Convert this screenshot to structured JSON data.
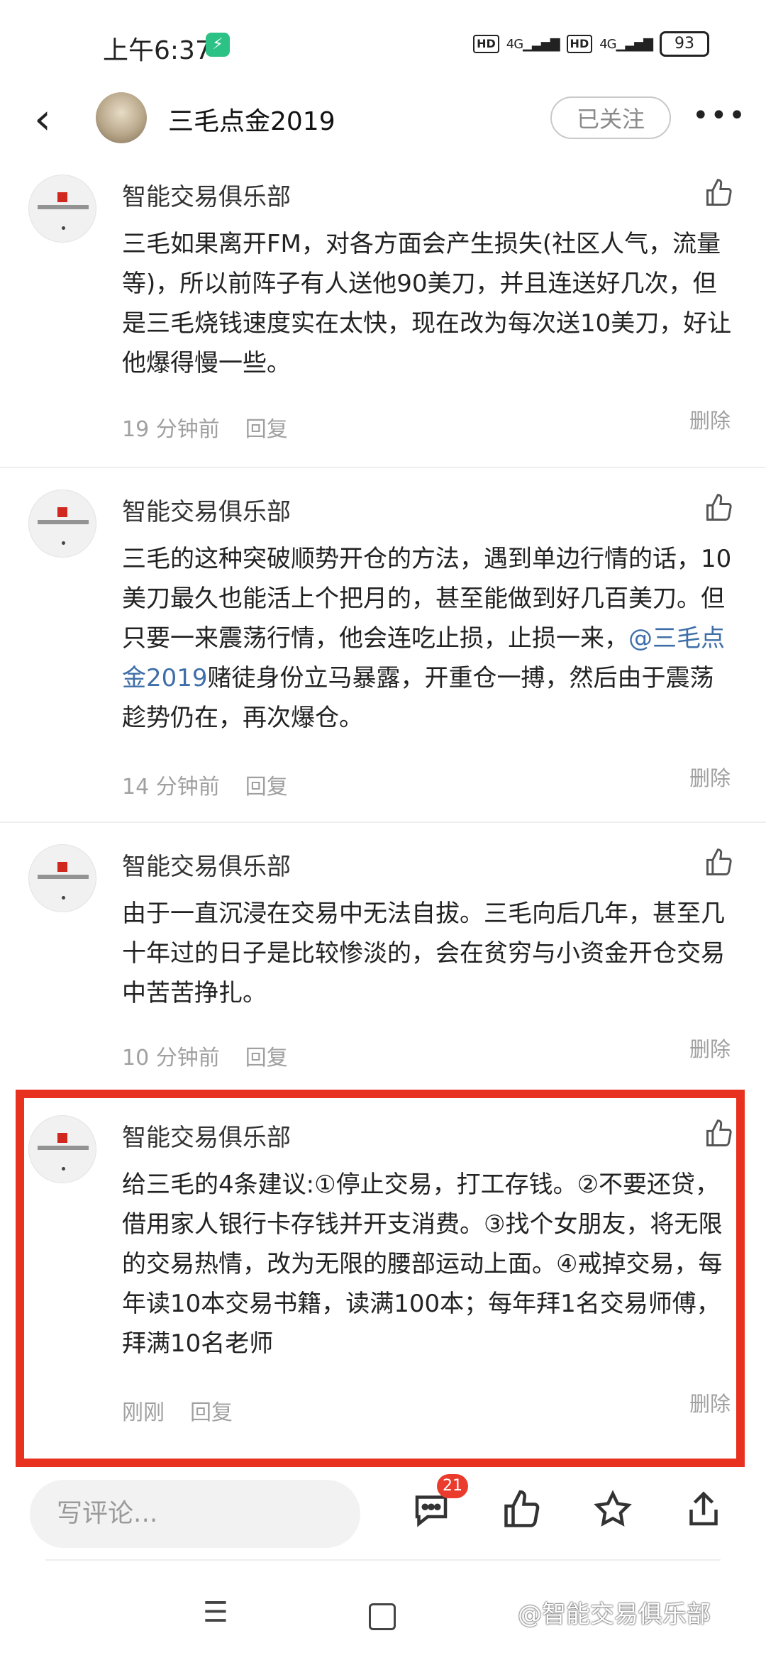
{
  "status_bar": {
    "time": "上午6:37",
    "network_1": "4G",
    "network_2": "4G",
    "hd_1": "HD",
    "hd_2": "HD",
    "battery": "93"
  },
  "header": {
    "title": "三毛点金2019",
    "follow_label": "已关注",
    "more_label": "•••"
  },
  "comments": [
    {
      "author": "智能交易俱乐部",
      "text": "三毛如果离开FM，对各方面会产生损失(社区人气，流量等)，所以前阵子有人送他90美刀，并且连送好几次，但是三毛烧钱速度实在太快，现在改为每次送10美刀，好让他爆得慢一些。",
      "time": "19 分钟前",
      "reply": "回复",
      "delete": "删除"
    },
    {
      "author": "智能交易俱乐部",
      "text_before": "三毛的这种突破顺势开仓的方法，遇到单边行情的话，10美刀最久也能活上个把月的，甚至能做到好几百美刀。但只要一来震荡行情，他会连吃止损，止损一来，",
      "mention": "@三毛点金2019",
      "text_after": "赌徒身份立马暴露，开重仓一搏，然后由于震荡趁势仍在，再次爆仓。",
      "time": "14 分钟前",
      "reply": "回复",
      "delete": "删除"
    },
    {
      "author": "智能交易俱乐部",
      "text": "由于一直沉浸在交易中无法自拔。三毛向后几年，甚至几十年过的日子是比较惨淡的，会在贫穷与小资金开仓交易中苦苦挣扎。",
      "time": "10 分钟前",
      "reply": "回复",
      "delete": "删除"
    },
    {
      "author": "智能交易俱乐部",
      "text": "给三毛的4条建议:①停止交易，打工存钱。②不要还贷，借用家人银行卡存钱并开支消费。③找个女朋友，将无限的交易热情，改为无限的腰部运动上面。④戒掉交易，每年读10本交易书籍，读满100本；每年拜1名交易师傅，拜满10名老师",
      "time": "刚刚",
      "reply": "回复",
      "delete": "删除"
    }
  ],
  "bottom_bar": {
    "comment_placeholder": "写评论...",
    "comment_count": "21"
  },
  "nav": {
    "menu_glyph": "☰"
  },
  "watermark": "@智能交易俱乐部",
  "colors": {
    "highlight_border": "#e8321f",
    "mention": "#3f6fa8",
    "badge": "#ea3b2c"
  }
}
